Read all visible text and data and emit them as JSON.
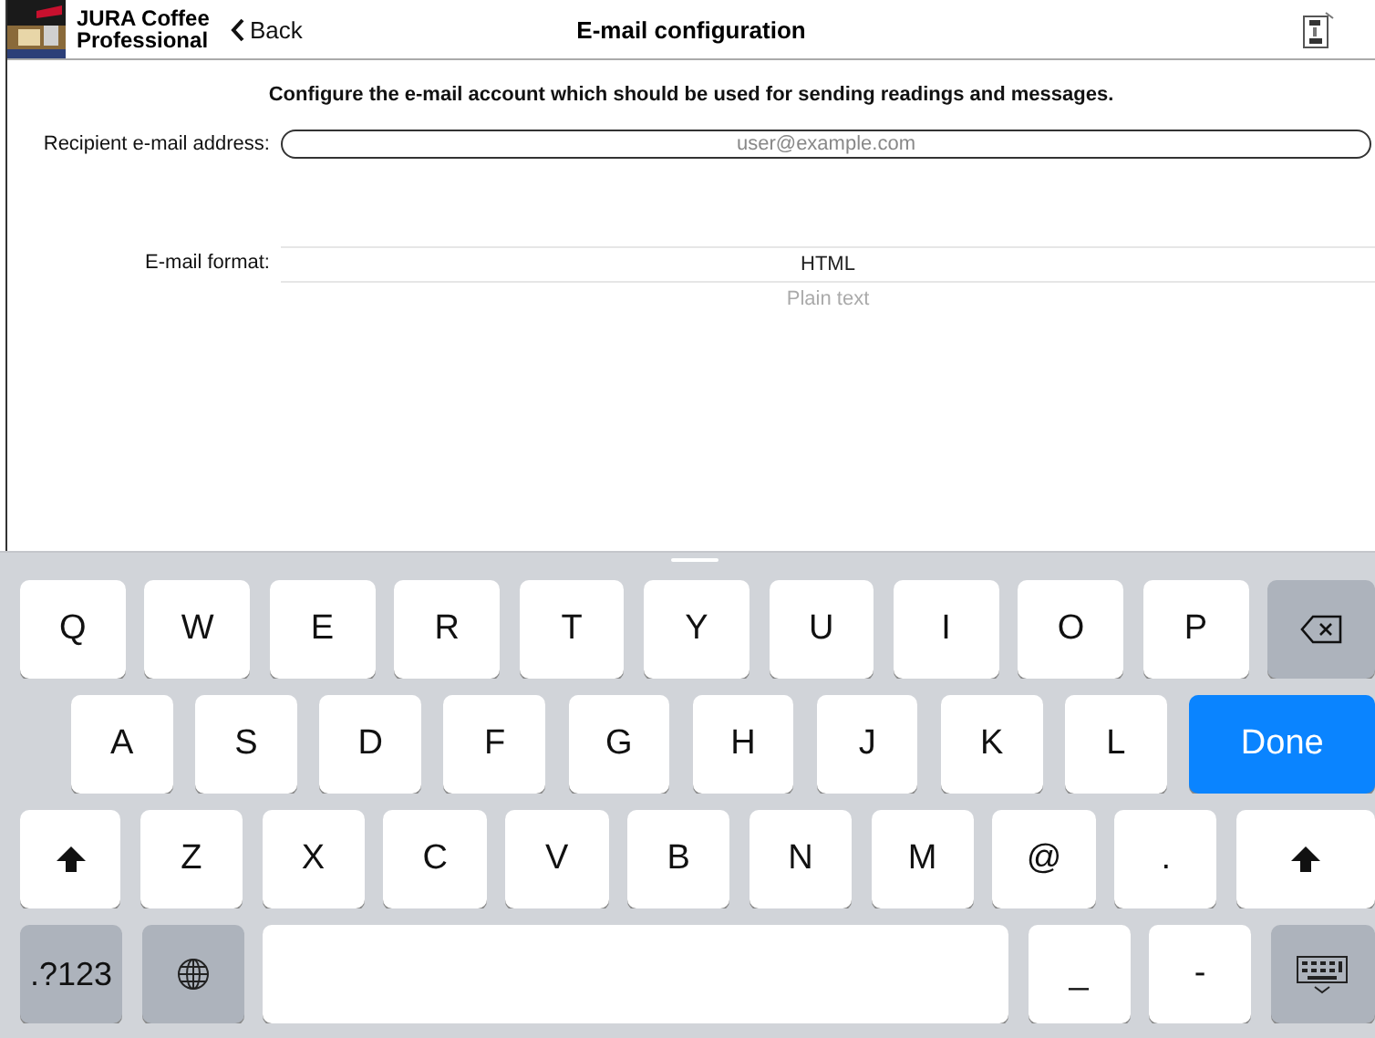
{
  "header": {
    "app_name": "JURA Coffee Professional",
    "back": "Back",
    "title": "E-mail configuration"
  },
  "intro": "Configure the e-mail account which should be used for sending readings and messages.",
  "recipient": {
    "label": "Recipient e-mail address:",
    "placeholder": "user@example.com"
  },
  "format": {
    "label": "E-mail format:",
    "options": [
      {
        "label": "HTML",
        "selected": true
      },
      {
        "label": "Plain text",
        "selected": false
      }
    ]
  },
  "keyboard": {
    "rows": [
      [
        {
          "kind": "letter",
          "label": "Q"
        },
        {
          "kind": "letter",
          "label": "W"
        },
        {
          "kind": "letter",
          "label": "E"
        },
        {
          "kind": "letter",
          "label": "R"
        },
        {
          "kind": "letter",
          "label": "T"
        },
        {
          "kind": "letter",
          "label": "Y"
        },
        {
          "kind": "letter",
          "label": "U"
        },
        {
          "kind": "letter",
          "label": "I"
        },
        {
          "kind": "letter",
          "label": "O"
        },
        {
          "kind": "letter",
          "label": "P"
        },
        {
          "kind": "backspace"
        }
      ],
      [
        {
          "kind": "letter",
          "label": "A"
        },
        {
          "kind": "letter",
          "label": "S"
        },
        {
          "kind": "letter",
          "label": "D"
        },
        {
          "kind": "letter",
          "label": "F"
        },
        {
          "kind": "letter",
          "label": "G"
        },
        {
          "kind": "letter",
          "label": "H"
        },
        {
          "kind": "letter",
          "label": "J"
        },
        {
          "kind": "letter",
          "label": "K"
        },
        {
          "kind": "letter",
          "label": "L"
        },
        {
          "kind": "action",
          "label": "Done"
        }
      ],
      [
        {
          "kind": "shift"
        },
        {
          "kind": "letter",
          "label": "Z"
        },
        {
          "kind": "letter",
          "label": "X"
        },
        {
          "kind": "letter",
          "label": "C"
        },
        {
          "kind": "letter",
          "label": "V"
        },
        {
          "kind": "letter",
          "label": "B"
        },
        {
          "kind": "letter",
          "label": "N"
        },
        {
          "kind": "letter",
          "label": "M"
        },
        {
          "kind": "letter",
          "label": "@"
        },
        {
          "kind": "letter",
          "label": "."
        },
        {
          "kind": "shift"
        }
      ],
      [
        {
          "kind": "modifier",
          "label": ".?123"
        },
        {
          "kind": "globe"
        },
        {
          "kind": "space"
        },
        {
          "kind": "letter",
          "label": "_"
        },
        {
          "kind": "letter",
          "label": "-"
        },
        {
          "kind": "hide"
        }
      ]
    ]
  }
}
